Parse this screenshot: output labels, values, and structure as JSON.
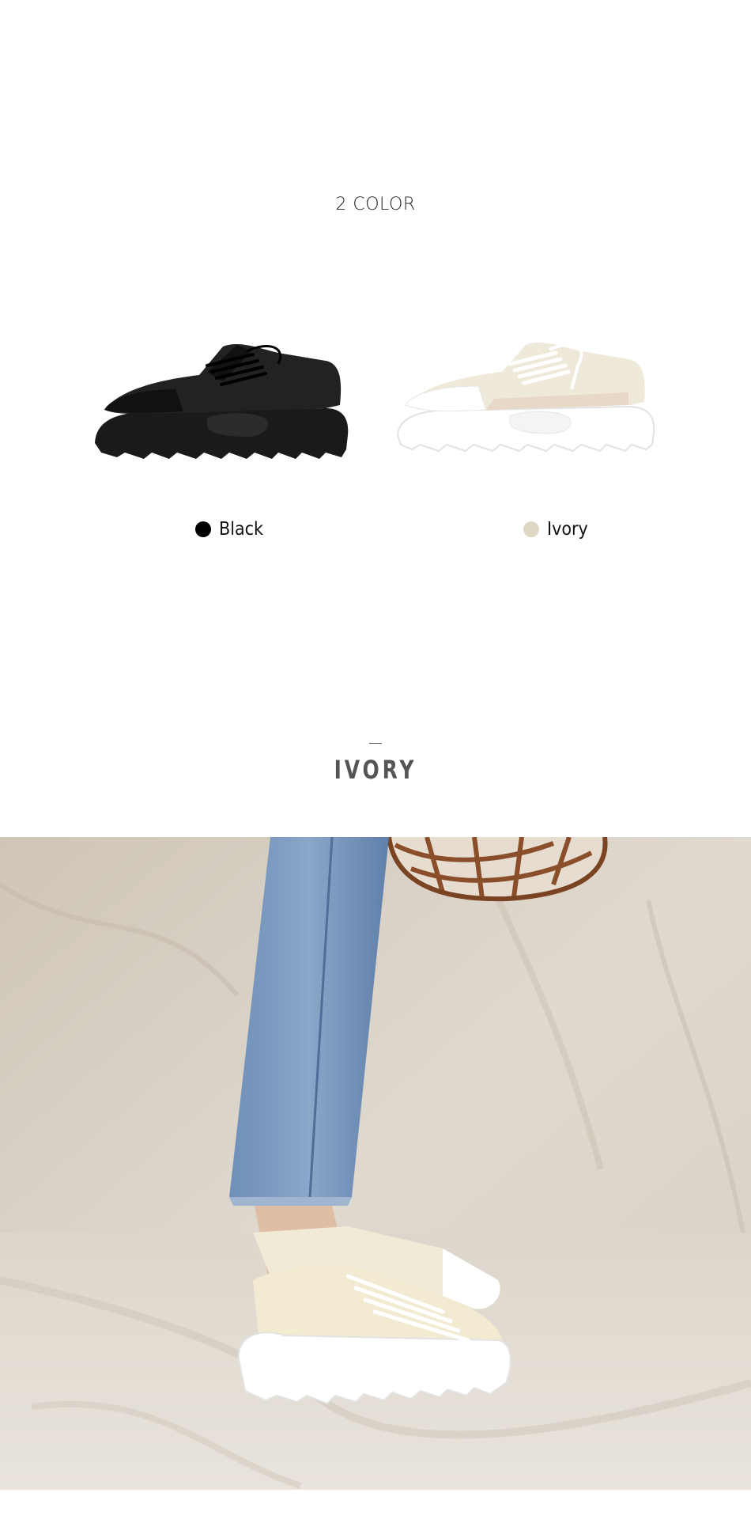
{
  "colors_section": {
    "title": "2 COLOR",
    "options": [
      {
        "label": "Black",
        "swatch": "#000000"
      },
      {
        "label": "Ivory",
        "swatch": "#ddd7c3"
      }
    ]
  },
  "detail_section": {
    "heading": "IVORY"
  },
  "photo": {
    "icon": "lifestyle-photo"
  }
}
